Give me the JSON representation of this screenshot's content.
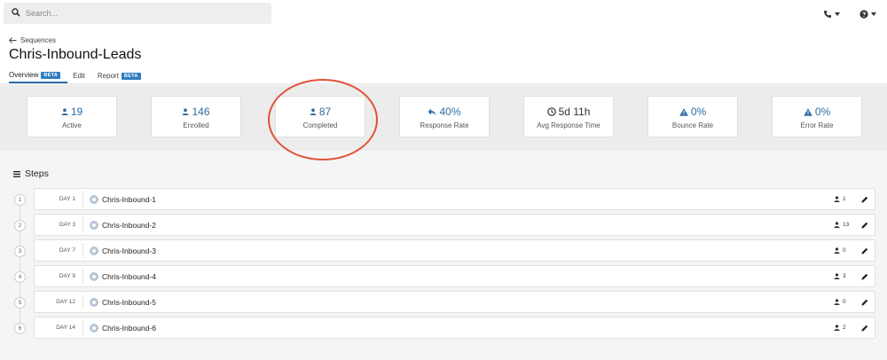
{
  "search": {
    "placeholder": "Search..."
  },
  "header": {
    "back_label": "Sequences",
    "title": "Chris-Inbound-Leads",
    "tabs": [
      {
        "label": "Overview",
        "badge": "BETA"
      },
      {
        "label": "Edit"
      },
      {
        "label": "Report",
        "badge": "BETA"
      }
    ]
  },
  "stats": [
    {
      "value": "19",
      "label": "Active",
      "icon": "user-icon"
    },
    {
      "value": "146",
      "label": "Enrolled",
      "icon": "user-icon"
    },
    {
      "value": "87",
      "label": "Completed",
      "icon": "user-icon"
    },
    {
      "value": "40%",
      "label": "Response Rate",
      "icon": "reply-icon"
    },
    {
      "value": "5d 11h",
      "label": "Avg Response Time",
      "icon": "clock-icon"
    },
    {
      "value": "0%",
      "label": "Bounce Rate",
      "icon": "warning-icon"
    },
    {
      "value": "0%",
      "label": "Error Rate",
      "icon": "warning-icon"
    }
  ],
  "steps_title": "Steps",
  "steps": [
    {
      "num": "1",
      "day": "DAY 1",
      "name": "Chris-Inbound-1",
      "count": "1"
    },
    {
      "num": "2",
      "day": "DAY 3",
      "name": "Chris-Inbound-2",
      "count": "13"
    },
    {
      "num": "3",
      "day": "DAY 7",
      "name": "Chris-Inbound-3",
      "count": "0"
    },
    {
      "num": "4",
      "day": "DAY 9",
      "name": "Chris-Inbound-4",
      "count": "3"
    },
    {
      "num": "5",
      "day": "DAY 12",
      "name": "Chris-Inbound-5",
      "count": "0"
    },
    {
      "num": "6",
      "day": "DAY 14",
      "name": "Chris-Inbound-6",
      "count": "2"
    }
  ],
  "colors": {
    "accent": "#2d6ea6",
    "badge": "#2d7cc1",
    "highlight": "#e2513a"
  }
}
